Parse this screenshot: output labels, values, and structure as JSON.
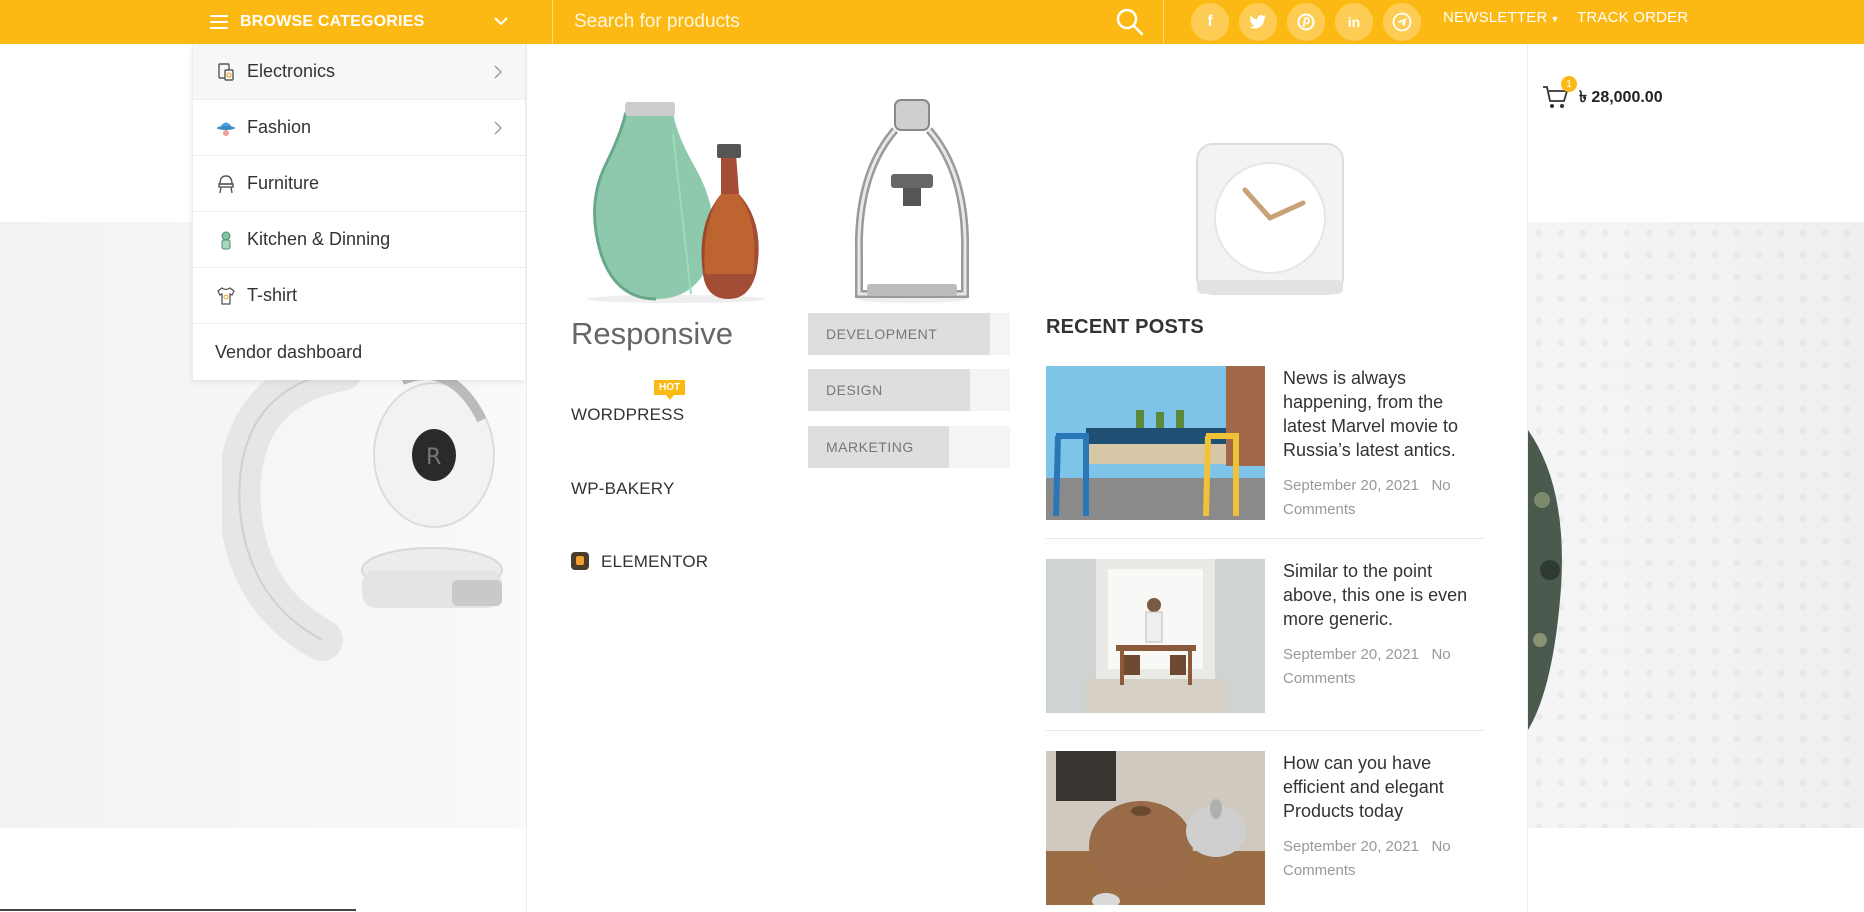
{
  "topbar": {
    "browse_label": "BROWSE CATEGORIES",
    "search_placeholder": "Search for products",
    "social": [
      "facebook",
      "twitter",
      "pinterest",
      "linkedin",
      "telegram"
    ],
    "newsletter": "NEWSLETTER",
    "track_order": "TRACK ORDER",
    "accent_color": "#fdb913"
  },
  "cart": {
    "count": "1",
    "amount": "৳ 28,000.00"
  },
  "categories": [
    {
      "label": "Electronics",
      "icon": "electronics-icon",
      "has_submenu": true
    },
    {
      "label": "Fashion",
      "icon": "fashion-icon",
      "has_submenu": true
    },
    {
      "label": "Furniture",
      "icon": "furniture-icon",
      "has_submenu": false
    },
    {
      "label": "Kitchen & Dinning",
      "icon": "kitchen-icon",
      "has_submenu": false
    },
    {
      "label": "T-shirt",
      "icon": "tshirt-icon",
      "has_submenu": false
    },
    {
      "label": "Vendor dashboard",
      "icon": "",
      "has_submenu": false
    }
  ],
  "mega": {
    "products": [
      "carafe-product-image",
      "espresso-maker-product-image",
      "clock-product-image"
    ],
    "responsive_heading": "Responsive",
    "links": {
      "wordpress": "WORDPRESS",
      "wordpress_badge": "HOT",
      "wpbakery": "WP-BAKERY",
      "elementor": "ELEMENTOR"
    },
    "skills": [
      {
        "label": "DEVELOPMENT",
        "level": 0.9
      },
      {
        "label": "DESIGN",
        "level": 0.8
      },
      {
        "label": "MARKETING",
        "level": 0.7
      }
    ],
    "recent_posts_title": "RECENT POSTS",
    "posts": [
      {
        "title": "News is always happening, from the latest Marvel movie to Russia’s latest antics.",
        "date": "September 20, 2021",
        "comments": "No Comments"
      },
      {
        "title": "Similar to the point above, this one is even more generic.",
        "date": "September 20, 2021",
        "comments": "No Comments"
      },
      {
        "title": "How can you have efficient and elegant Products today",
        "date": "September 20, 2021",
        "comments": "No Comments"
      }
    ]
  }
}
